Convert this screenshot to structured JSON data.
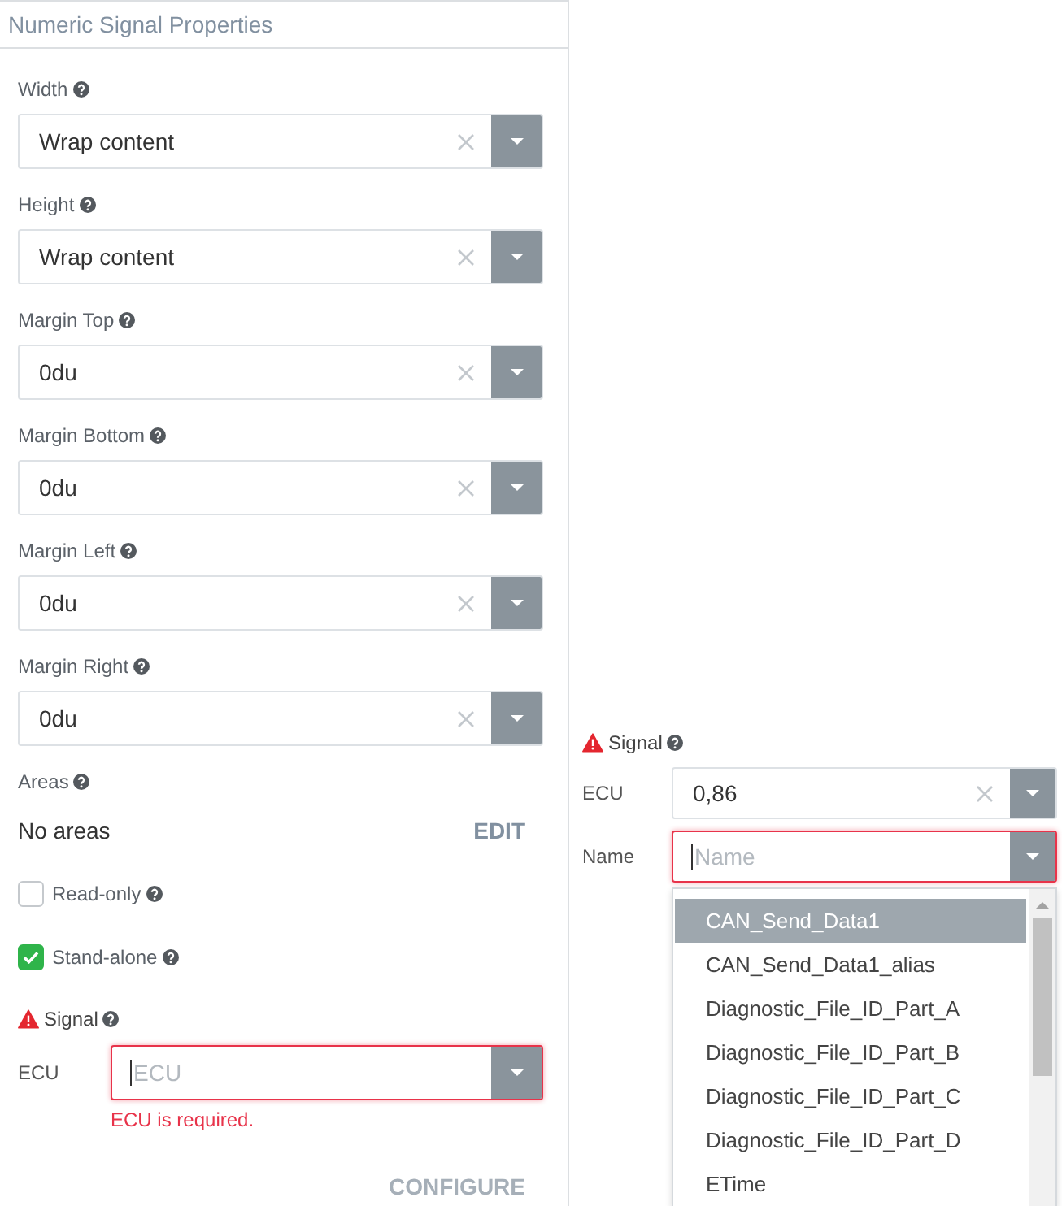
{
  "panel": {
    "title": "Numeric Signal Properties"
  },
  "fields": [
    {
      "label": "Width",
      "value": "Wrap content"
    },
    {
      "label": "Height",
      "value": "Wrap content"
    },
    {
      "label": "Margin Top",
      "value": "0du"
    },
    {
      "label": "Margin Bottom",
      "value": "0du"
    },
    {
      "label": "Margin Left",
      "value": "0du"
    },
    {
      "label": "Margin Right",
      "value": "0du"
    }
  ],
  "areas": {
    "label": "Areas",
    "value": "No areas",
    "action": "EDIT"
  },
  "checkboxes": [
    {
      "label": "Read-only",
      "checked": false
    },
    {
      "label": "Stand-alone",
      "checked": true
    }
  ],
  "signal": {
    "title": "Signal",
    "warning": true,
    "fields": [
      {
        "label": "ECU",
        "placeholder": "ECU",
        "invalid": true,
        "focused": true,
        "error": "ECU is required."
      }
    ]
  },
  "configure_button": {
    "label": "CONFIGURE",
    "disabled": true
  },
  "signal_popup": {
    "title": "Signal",
    "warning": true,
    "fields": [
      {
        "label": "ECU",
        "value": "0,86",
        "invalid": false,
        "focused": false
      },
      {
        "label": "Name",
        "placeholder": "Name",
        "invalid": true,
        "focused": true
      }
    ],
    "options": [
      {
        "label": "CAN_Send_Data1",
        "selected": true
      },
      {
        "label": "CAN_Send_Data1_alias",
        "selected": false
      },
      {
        "label": "Diagnostic_File_ID_Part_A",
        "selected": false
      },
      {
        "label": "Diagnostic_File_ID_Part_B",
        "selected": false
      },
      {
        "label": "Diagnostic_File_ID_Part_C",
        "selected": false
      },
      {
        "label": "Diagnostic_File_ID_Part_D",
        "selected": false
      },
      {
        "label": "ETime",
        "selected": false
      }
    ]
  }
}
